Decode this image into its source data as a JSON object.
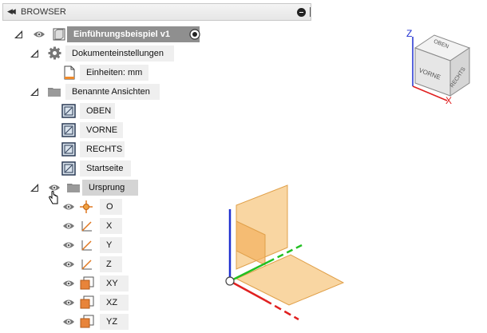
{
  "browser": {
    "title": "BROWSER",
    "collapse_icon": "double-left-arrow-icon"
  },
  "tree": {
    "root": {
      "label": "Einführungsbeispiel v1",
      "icon": "component-icon",
      "active_icon": "radio-active-icon"
    },
    "document_settings": {
      "label": "Dokumenteinstellungen",
      "icon": "gear-icon"
    },
    "units": {
      "label": "Einheiten: mm",
      "icon": "document-icon"
    },
    "named_views": {
      "label": "Benannte Ansichten",
      "icon": "folder-icon"
    },
    "views": [
      {
        "label": "OBEN",
        "icon": "view-icon"
      },
      {
        "label": "VORNE",
        "icon": "view-icon"
      },
      {
        "label": "RECHTS",
        "icon": "view-icon"
      },
      {
        "label": "Startseite",
        "icon": "view-icon"
      }
    ],
    "origin": {
      "label": "Ursprung",
      "icon": "folder-icon"
    },
    "origin_items": [
      {
        "label": "O",
        "icon": "origin-point-icon"
      },
      {
        "label": "X",
        "icon": "axis-icon"
      },
      {
        "label": "Y",
        "icon": "axis-icon"
      },
      {
        "label": "Z",
        "icon": "axis-icon"
      },
      {
        "label": "XY",
        "icon": "plane-icon"
      },
      {
        "label": "XZ",
        "icon": "plane-icon"
      },
      {
        "label": "YZ",
        "icon": "plane-icon"
      }
    ]
  },
  "viewcube": {
    "top": "OBEN",
    "front": "VORNE",
    "right": "RECHTS",
    "axis_x": "X",
    "axis_z": "Z"
  },
  "colors": {
    "x_axis": "#e02020",
    "y_axis": "#22c022",
    "z_axis": "#2030d0",
    "plane_fill": "#f7c57a",
    "plane_stroke": "#e0a04a"
  }
}
